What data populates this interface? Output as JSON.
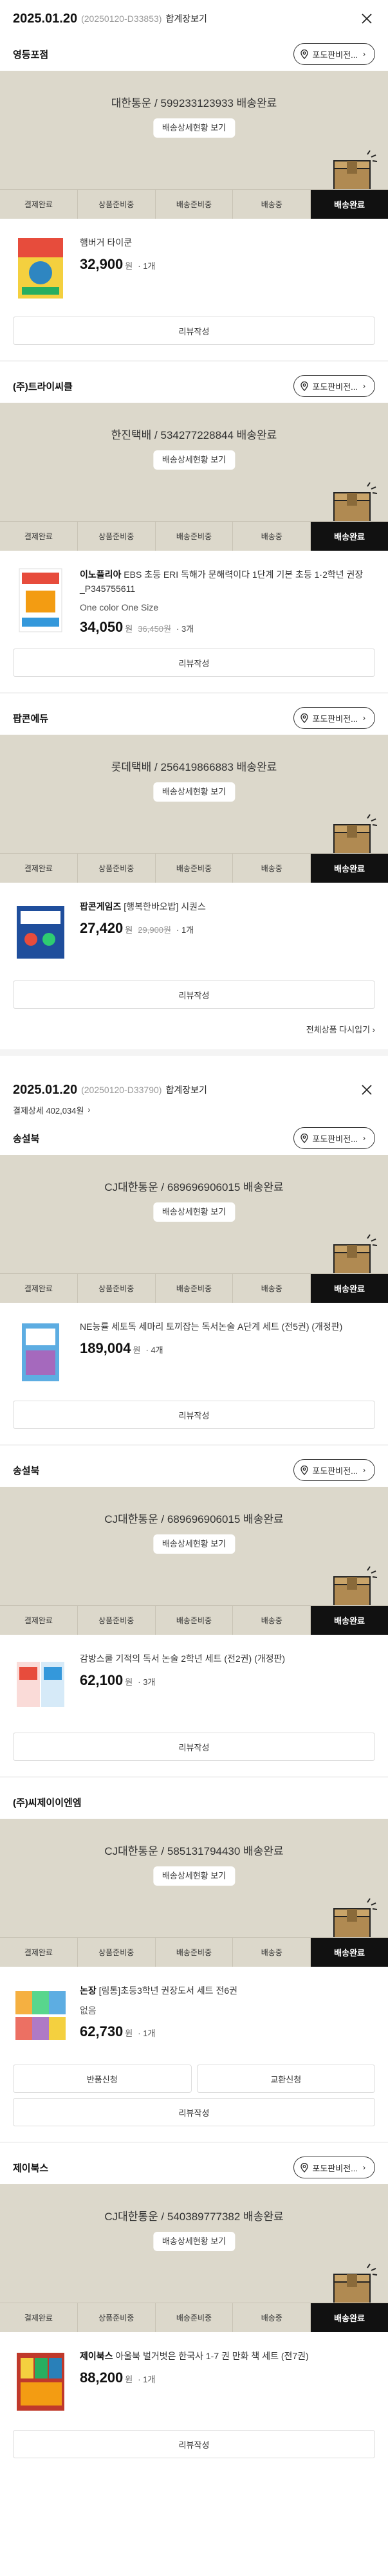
{
  "orders": [
    {
      "date": "2025.01.20",
      "order_no": "(20250120-D33853)",
      "detail_link": "합계장보기",
      "close_icon": "close-icon"
    },
    {
      "date": "2025.01.20",
      "order_no": "(20250120-D33790)",
      "detail_link": "합계장보기",
      "payment_detail": "결제상세 402,034원",
      "close_icon": "close-icon"
    }
  ],
  "common": {
    "store_button": "포도판비전...",
    "tracking_button": "배송상세현황 보기",
    "steps": [
      "결제완료",
      "상품준비중",
      "배송준비중",
      "배송중",
      "배송완료"
    ],
    "review_button": "리뷰작성",
    "return_button": "반품신청",
    "exchange_button": "교환신청",
    "won": "원",
    "more_products": "전체상품 다시입기"
  },
  "sellers": [
    {
      "name": "영등포점",
      "delivery": "대한통운 / 599233123933 배송완료",
      "product": {
        "brand": "",
        "title": "햄버거 타이쿤",
        "option": "",
        "price": "32,900",
        "orig": "",
        "qty": "· 1개"
      }
    },
    {
      "name": "(주)트라이씨클",
      "delivery": "한진택배 / 534277228844 배송완료",
      "product": {
        "brand": "이노플리아",
        "title": " EBS 초등 ERI 독해가 문해력이다 1단계 기본 초등 1·2학년 권장_P345755611",
        "option": "One color One Size",
        "price": "34,050",
        "orig": "36,450원",
        "qty": "· 3개"
      }
    },
    {
      "name": "팝콘에듀",
      "delivery": "롯데택배 / 256419866883 배송완료",
      "product": {
        "brand": "팝콘게임즈",
        "title": " [행복한바오밥] 시퀀스",
        "option": "",
        "price": "27,420",
        "orig": "29,900원",
        "qty": "· 1개"
      }
    },
    {
      "name": "송설북",
      "delivery": "CJ대한통운 / 689696906015 배송완료",
      "product": {
        "brand": "",
        "title": "NE능률 세토독 세마리 토끼잡는 독서논술 A단계 세트 (전5권) (개정판)",
        "option": "",
        "price": "189,004",
        "orig": "",
        "qty": "· 4개"
      }
    },
    {
      "name": "송설북",
      "delivery": "CJ대한통운 / 689696906015 배송완료",
      "product": {
        "brand": "",
        "title": "감방스쿨 기적의 독서 논술 2학년 세트 (전2권) (개정판)",
        "option": "",
        "price": "62,100",
        "orig": "",
        "qty": "· 3개"
      }
    },
    {
      "name": "(주)씨제이이엔엠",
      "delivery": "CJ대한통운 / 585131794430 배송완료",
      "product": {
        "brand": "논장",
        "title": " [림통]초등3학년 권장도서 세트 전6권",
        "option": "없음",
        "price": "62,730",
        "orig": "",
        "qty": "· 1개"
      }
    },
    {
      "name": "제이북스",
      "delivery": "CJ대한통운 / 540389777382 배송완료",
      "product": {
        "brand": "제이북스",
        "title": " 아울북 벌거벗은 한국사 1-7 권 만화 책 세트 (전7권)",
        "option": "",
        "price": "88,200",
        "orig": "",
        "qty": "· 1개"
      }
    }
  ],
  "icons": {
    "pin": "map-pin-icon",
    "box": "delivered-box-icon",
    "chevron": "chevron-right-icon"
  },
  "colors": {
    "delivery_bg": "#dcd8cb",
    "active_step": "#111111",
    "text": "#222222"
  }
}
